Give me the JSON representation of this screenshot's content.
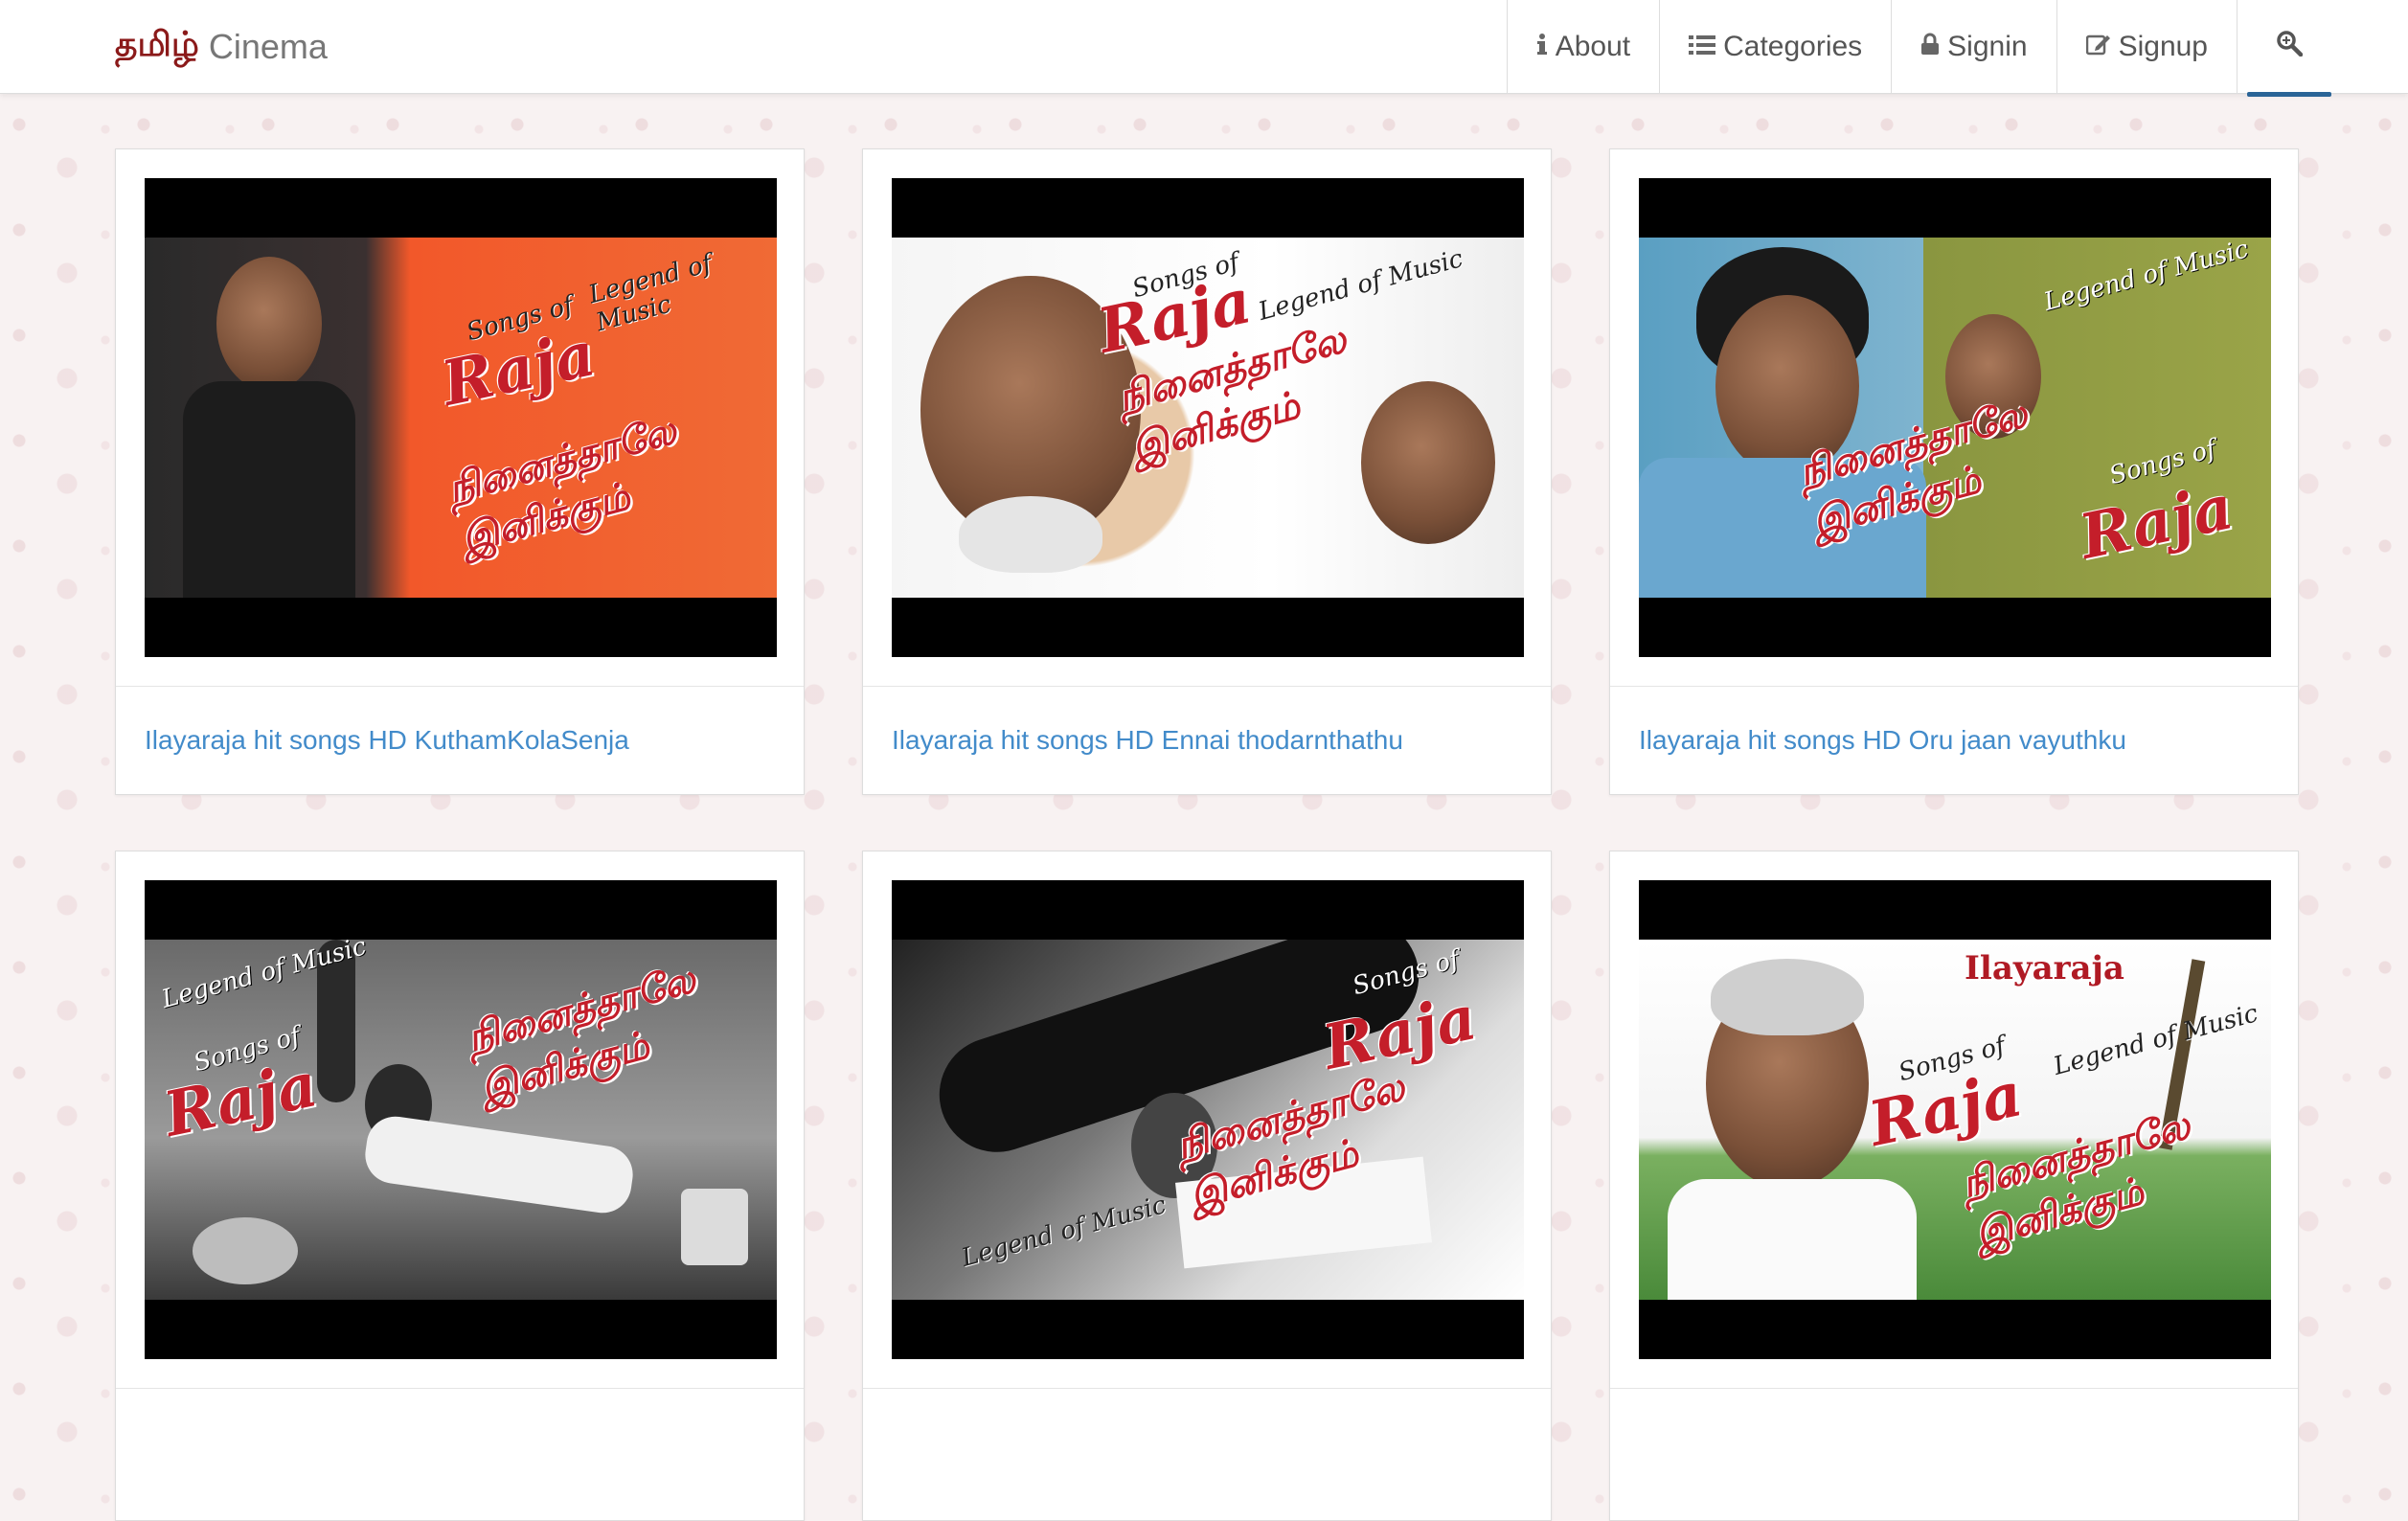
{
  "brand": {
    "tamil": "தமிழ்",
    "name": "Cinema"
  },
  "nav": {
    "about": "About",
    "categories": "Categories",
    "signin": "Signin",
    "signup": "Signup"
  },
  "cards": [
    {
      "title": "Ilayaraja hit songs HD KuthamKolaSenja",
      "art": {
        "raja": "Raja",
        "songs": "Songs of",
        "legend": "Legend of Music",
        "tamil": "நினைத்தாலே இனிக்கும்"
      }
    },
    {
      "title": "Ilayaraja hit songs HD Ennai thodarnthathu",
      "art": {
        "raja": "Raja",
        "songs": "Songs of",
        "legend": "Legend of Music",
        "tamil": "நினைத்தாலே இனிக்கும்"
      }
    },
    {
      "title": "Ilayaraja hit songs HD Oru jaan vayuthku",
      "art": {
        "raja": "Raja",
        "songs": "Songs of",
        "legend": "Legend of Music",
        "tamil": "நினைத்தாலே இனிக்கும்"
      }
    },
    {
      "title": "",
      "art": {
        "raja": "Raja",
        "songs": "Songs of",
        "legend": "Legend of Music",
        "tamil": "நினைத்தாலே இனிக்கும்"
      }
    },
    {
      "title": "",
      "art": {
        "raja": "Raja",
        "songs": "Songs of",
        "legend": "Legend of Music",
        "tamil": "நினைத்தாலே இனிக்கும்"
      }
    },
    {
      "title": "",
      "art": {
        "name": "Ilayaraja",
        "raja": "Raja",
        "songs": "Songs of",
        "legend": "Legend of Music",
        "tamil": "நினைத்தாலே இனிக்கும்"
      }
    }
  ],
  "colors": {
    "brand_tamil": "#8b1a1a",
    "link": "#428bca",
    "art_red": "#c41e2a"
  },
  "icons": {
    "about": "info-icon",
    "categories": "list-icon",
    "signin": "lock-icon",
    "signup": "edit-icon",
    "search": "search-icon"
  }
}
